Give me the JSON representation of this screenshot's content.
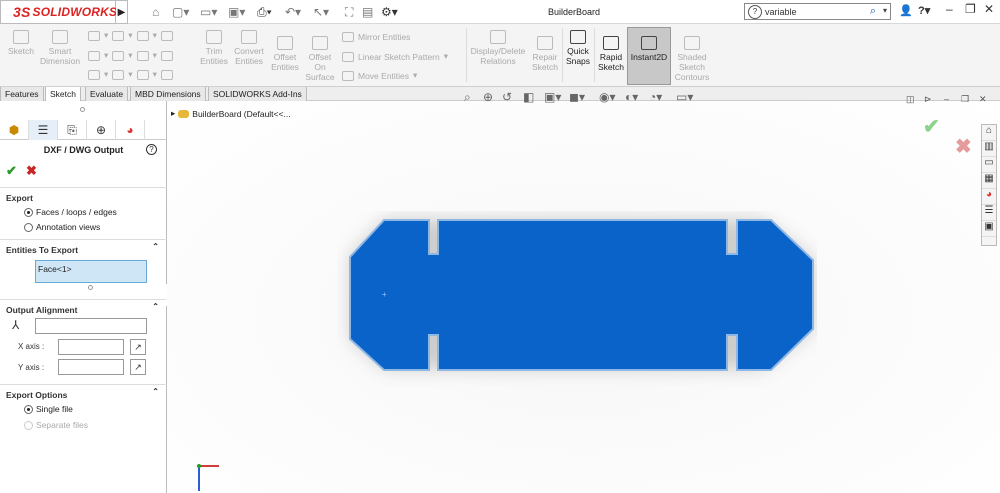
{
  "app": {
    "logo_text": "SOLIDWORKS",
    "logo_prefix": "3S",
    "doc_title": "BuilderBoard"
  },
  "search": {
    "value": "variable",
    "help_glyph": "?"
  },
  "ribbon": {
    "groups": [
      {
        "label": "Sketch"
      },
      {
        "label": "Smart Dimension"
      },
      {
        "label": "Trim Entities"
      },
      {
        "label": "Convert Entities"
      },
      {
        "label": "Offset Entities"
      },
      {
        "label": "Offset On Surface"
      },
      {
        "label": "Mirror Entities"
      },
      {
        "label": "Linear Sketch Pattern"
      },
      {
        "label": "Move Entities"
      },
      {
        "label": "Display/Delete Relations"
      },
      {
        "label": "Repair Sketch"
      },
      {
        "label": "Quick Snaps"
      },
      {
        "label": "Rapid Sketch"
      },
      {
        "label": "Instant2D"
      },
      {
        "label": "Shaded Sketch Contours"
      }
    ]
  },
  "tabs": [
    "Features",
    "Sketch",
    "Evaluate",
    "MBD Dimensions",
    "SOLIDWORKS Add-Ins"
  ],
  "active_tab": "Sketch",
  "panel": {
    "title": "DXF / DWG Output",
    "export": {
      "header": "Export",
      "options": [
        "Faces / loops / edges",
        "Annotation views"
      ],
      "selected": 0
    },
    "entities": {
      "header": "Entities To Export",
      "items": [
        "Face<1>"
      ]
    },
    "alignment": {
      "header": "Output Alignment",
      "x_label": "X axis :",
      "y_label": "Y axis :"
    },
    "export_options": {
      "header": "Export Options",
      "options": [
        "Single file",
        "Separate files"
      ],
      "selected": 0
    }
  },
  "tree": {
    "label": "BuilderBoard  (Default<<..."
  },
  "colors": {
    "part_blue": "#0a63c9",
    "part_edge": "#8fb7e3",
    "accent_red": "#d22222"
  }
}
